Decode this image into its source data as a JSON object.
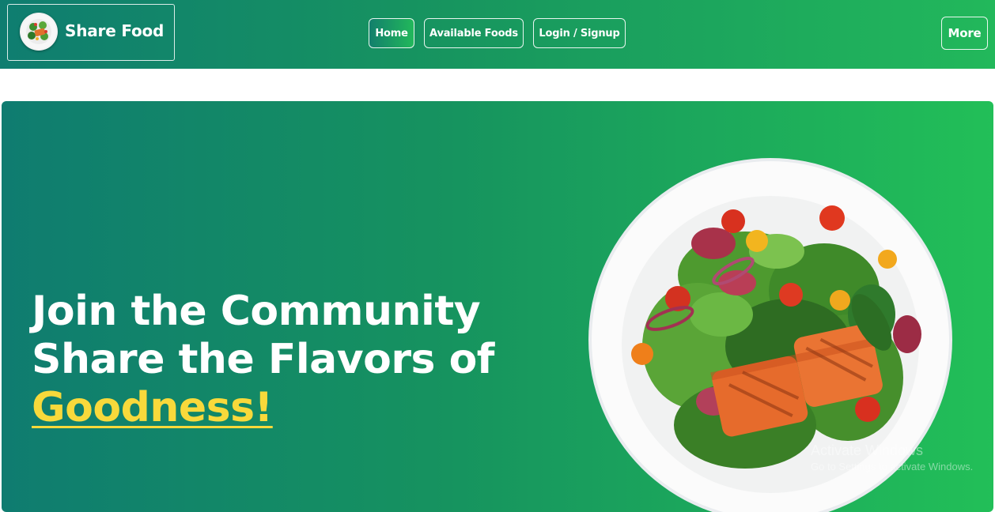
{
  "brand": {
    "name": "Share Food",
    "logo_icon": "salad-plate-icon"
  },
  "nav": {
    "items": [
      {
        "label": "Home",
        "active": true
      },
      {
        "label": "Available Foods",
        "active": false
      },
      {
        "label": "Login / Signup",
        "active": false
      }
    ],
    "more_label": "More"
  },
  "hero": {
    "line1": "Join the Community",
    "line2": "Share the Flavors of",
    "highlight": "Goodness!",
    "image_icon": "salmon-salad-plate-image"
  },
  "watermark": {
    "title": "Activate Windows",
    "subtitle": "Go to Settings to activate Windows."
  },
  "colors": {
    "gradient_start": "#0f7c70",
    "gradient_end": "#22bf58",
    "accent_yellow": "#f8d93b",
    "text": "#ffffff"
  }
}
